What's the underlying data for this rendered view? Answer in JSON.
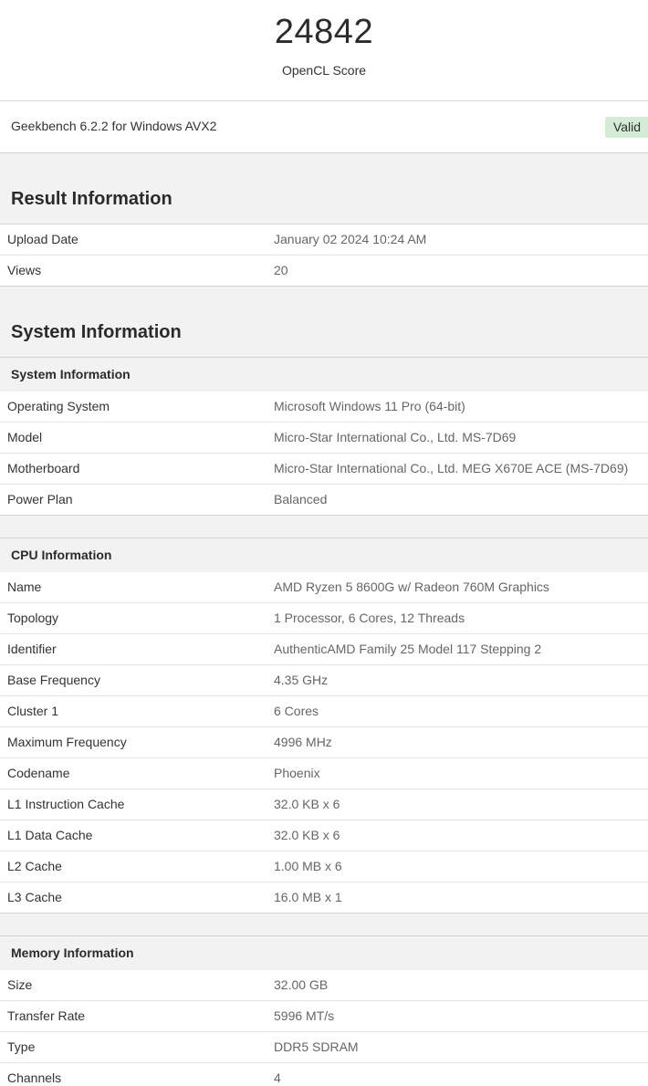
{
  "score": {
    "value": "24842",
    "label": "OpenCL Score"
  },
  "version": {
    "text": "Geekbench 6.2.2 for Windows AVX2",
    "badge": "Valid",
    "badge_color": "#d4ecd6"
  },
  "result_info": {
    "title": "Result Information",
    "rows": [
      {
        "name": "Upload Date",
        "value": "January 02 2024 10:24 AM"
      },
      {
        "name": "Views",
        "value": "20"
      }
    ]
  },
  "system_info": {
    "title": "System Information",
    "system": {
      "header": "System Information",
      "rows": [
        {
          "name": "Operating System",
          "value": "Microsoft Windows 11 Pro (64-bit)"
        },
        {
          "name": "Model",
          "value": "Micro-Star International Co., Ltd. MS-7D69"
        },
        {
          "name": "Motherboard",
          "value": "Micro-Star International Co., Ltd. MEG X670E ACE (MS-7D69)"
        },
        {
          "name": "Power Plan",
          "value": "Balanced"
        }
      ]
    },
    "cpu": {
      "header": "CPU Information",
      "rows": [
        {
          "name": "Name",
          "value": "AMD Ryzen 5 8600G w/ Radeon 760M Graphics"
        },
        {
          "name": "Topology",
          "value": "1 Processor, 6 Cores, 12 Threads"
        },
        {
          "name": "Identifier",
          "value": "AuthenticAMD Family 25 Model 117 Stepping 2"
        },
        {
          "name": "Base Frequency",
          "value": "4.35 GHz"
        },
        {
          "name": "Cluster 1",
          "value": "6 Cores"
        },
        {
          "name": "Maximum Frequency",
          "value": "4996 MHz"
        },
        {
          "name": "Codename",
          "value": "Phoenix"
        },
        {
          "name": "L1 Instruction Cache",
          "value": "32.0 KB x 6"
        },
        {
          "name": "L1 Data Cache",
          "value": "32.0 KB x 6"
        },
        {
          "name": "L2 Cache",
          "value": "1.00 MB x 6"
        },
        {
          "name": "L3 Cache",
          "value": "16.0 MB x 1"
        }
      ]
    },
    "memory": {
      "header": "Memory Information",
      "rows": [
        {
          "name": "Size",
          "value": "32.00 GB"
        },
        {
          "name": "Transfer Rate",
          "value": "5996 MT/s"
        },
        {
          "name": "Type",
          "value": "DDR5 SDRAM"
        },
        {
          "name": "Channels",
          "value": "4"
        }
      ]
    }
  }
}
